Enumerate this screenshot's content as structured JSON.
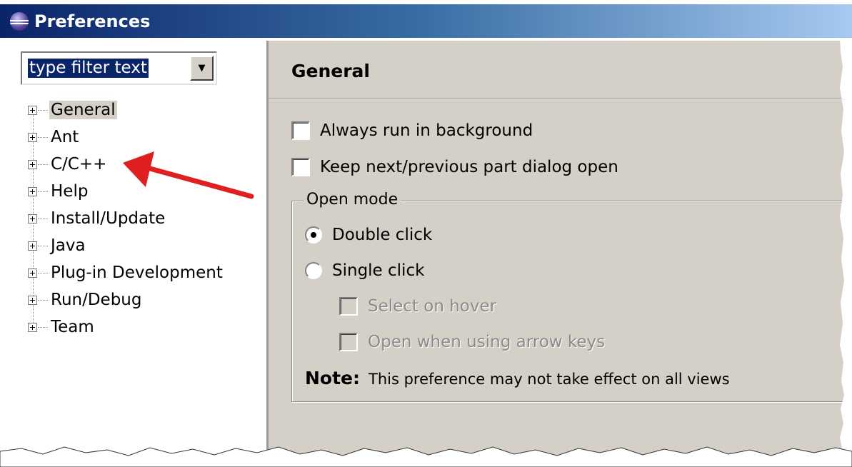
{
  "window": {
    "title": "Preferences"
  },
  "filter": {
    "value": "type filter text"
  },
  "tree": {
    "items": [
      {
        "label": "General",
        "selected": true
      },
      {
        "label": "Ant"
      },
      {
        "label": "C/C++"
      },
      {
        "label": "Help"
      },
      {
        "label": "Install/Update"
      },
      {
        "label": "Java"
      },
      {
        "label": "Plug-in Development"
      },
      {
        "label": "Run/Debug"
      },
      {
        "label": "Team"
      }
    ]
  },
  "page": {
    "title": "General",
    "always_run_background": {
      "label": "Always run in background",
      "checked": false
    },
    "keep_dialog_open": {
      "label": "Keep next/previous part dialog open",
      "checked": false
    },
    "open_mode": {
      "legend": "Open mode",
      "double_click": {
        "label": "Double click",
        "checked": true
      },
      "single_click": {
        "label": "Single click",
        "checked": false
      },
      "select_on_hover": {
        "label": "Select on hover",
        "enabled": false
      },
      "open_arrow_keys": {
        "label": "Open when using arrow keys",
        "enabled": false
      },
      "note_label": "Note:",
      "note_text": "This preference may not take effect on all views"
    }
  },
  "colors": {
    "title_gradient_start": "#0a246a",
    "title_gradient_end": "#a6caf0",
    "dialog_background": "#d4d0c8",
    "annotation_arrow": "#e02020"
  },
  "icons": [
    "eclipse-icon",
    "dropdown-arrow-icon",
    "expand-plus-icon",
    "annotation-arrow-icon"
  ]
}
